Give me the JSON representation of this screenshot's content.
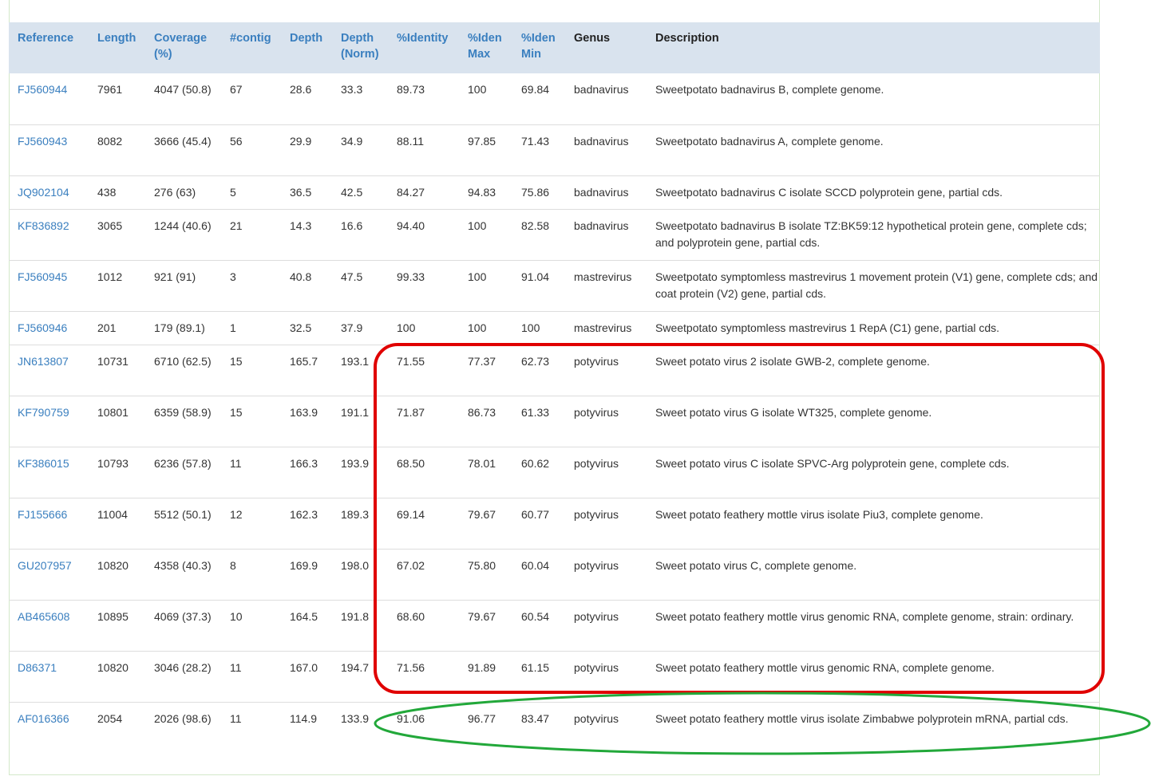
{
  "headers": [
    "Reference",
    "Length",
    "Coverage (%)",
    "#contig",
    "Depth",
    "Depth (Norm)",
    "%Identity",
    "%Iden Max",
    "%Iden Min",
    "Genus",
    "Description"
  ],
  "rows": [
    {
      "ref": "FJ560944",
      "length": "7961",
      "coverage": "4047 (50.8)",
      "contig": "67",
      "depth": "28.6",
      "depth_norm": "33.3",
      "identity": "89.73",
      "iden_max": "100",
      "iden_min": "69.84",
      "genus": "badnavirus",
      "desc": "Sweetpotato badnavirus B, complete genome."
    },
    {
      "ref": "FJ560943",
      "length": "8082",
      "coverage": "3666 (45.4)",
      "contig": "56",
      "depth": "29.9",
      "depth_norm": "34.9",
      "identity": "88.11",
      "iden_max": "97.85",
      "iden_min": "71.43",
      "genus": "badnavirus",
      "desc": "Sweetpotato badnavirus A, complete genome."
    },
    {
      "ref": "JQ902104",
      "length": "438",
      "coverage": "276 (63)",
      "contig": "5",
      "depth": "36.5",
      "depth_norm": "42.5",
      "identity": "84.27",
      "iden_max": "94.83",
      "iden_min": "75.86",
      "genus": "badnavirus",
      "desc": "Sweetpotato badnavirus C isolate SCCD polyprotein gene, partial cds."
    },
    {
      "ref": "KF836892",
      "length": "3065",
      "coverage": "1244 (40.6)",
      "contig": "21",
      "depth": "14.3",
      "depth_norm": "16.6",
      "identity": "94.40",
      "iden_max": "100",
      "iden_min": "82.58",
      "genus": "badnavirus",
      "desc": "Sweetpotato badnavirus B isolate TZ:BK59:12 hypothetical protein gene, complete cds; and polyprotein gene, partial cds."
    },
    {
      "ref": "FJ560945",
      "length": "1012",
      "coverage": "921 (91)",
      "contig": "3",
      "depth": "40.8",
      "depth_norm": "47.5",
      "identity": "99.33",
      "iden_max": "100",
      "iden_min": "91.04",
      "genus": "mastrevirus",
      "desc": "Sweetpotato symptomless mastrevirus 1 movement protein (V1) gene, complete cds; and coat protein (V2) gene, partial cds."
    },
    {
      "ref": "FJ560946",
      "length": "201",
      "coverage": "179 (89.1)",
      "contig": "1",
      "depth": "32.5",
      "depth_norm": "37.9",
      "identity": "100",
      "iden_max": "100",
      "iden_min": "100",
      "genus": "mastrevirus",
      "desc": "Sweetpotato symptomless mastrevirus 1 RepA (C1) gene, partial cds."
    },
    {
      "ref": "JN613807",
      "length": "10731",
      "coverage": "6710 (62.5)",
      "contig": "15",
      "depth": "165.7",
      "depth_norm": "193.1",
      "identity": "71.55",
      "iden_max": "77.37",
      "iden_min": "62.73",
      "genus": "potyvirus",
      "desc": "Sweet potato virus 2 isolate GWB-2, complete genome."
    },
    {
      "ref": "KF790759",
      "length": "10801",
      "coverage": "6359 (58.9)",
      "contig": "15",
      "depth": "163.9",
      "depth_norm": "191.1",
      "identity": "71.87",
      "iden_max": "86.73",
      "iden_min": "61.33",
      "genus": "potyvirus",
      "desc": "Sweet potato virus G isolate WT325, complete genome."
    },
    {
      "ref": "KF386015",
      "length": "10793",
      "coverage": "6236 (57.8)",
      "contig": "11",
      "depth": "166.3",
      "depth_norm": "193.9",
      "identity": "68.50",
      "iden_max": "78.01",
      "iden_min": "60.62",
      "genus": "potyvirus",
      "desc": "Sweet potato virus C isolate SPVC-Arg polyprotein gene, complete cds."
    },
    {
      "ref": "FJ155666",
      "length": "11004",
      "coverage": "5512 (50.1)",
      "contig": "12",
      "depth": "162.3",
      "depth_norm": "189.3",
      "identity": "69.14",
      "iden_max": "79.67",
      "iden_min": "60.77",
      "genus": "potyvirus",
      "desc": "Sweet potato feathery mottle virus isolate Piu3, complete genome."
    },
    {
      "ref": "GU207957",
      "length": "10820",
      "coverage": "4358 (40.3)",
      "contig": "8",
      "depth": "169.9",
      "depth_norm": "198.0",
      "identity": "67.02",
      "iden_max": "75.80",
      "iden_min": "60.04",
      "genus": "potyvirus",
      "desc": "Sweet potato virus C, complete genome."
    },
    {
      "ref": "AB465608",
      "length": "10895",
      "coverage": "4069 (37.3)",
      "contig": "10",
      "depth": "164.5",
      "depth_norm": "191.8",
      "identity": "68.60",
      "iden_max": "79.67",
      "iden_min": "60.54",
      "genus": "potyvirus",
      "desc": "Sweet potato feathery mottle virus genomic RNA, complete genome, strain: ordinary."
    },
    {
      "ref": "D86371",
      "length": "10820",
      "coverage": "3046 (28.2)",
      "contig": "11",
      "depth": "167.0",
      "depth_norm": "194.7",
      "identity": "71.56",
      "iden_max": "91.89",
      "iden_min": "61.15",
      "genus": "potyvirus",
      "desc": "Sweet potato feathery mottle virus genomic RNA, complete genome."
    },
    {
      "ref": "AF016366",
      "length": "2054",
      "coverage": "2026 (98.6)",
      "contig": "11",
      "depth": "114.9",
      "depth_norm": "133.9",
      "identity": "91.06",
      "iden_max": "96.77",
      "iden_min": "83.47",
      "genus": "potyvirus",
      "desc": "Sweet potato feathery mottle virus isolate Zimbabwe polyprotein mRNA, partial cds."
    }
  ],
  "colors": {
    "header_bg": "#d9e3ee",
    "link": "#3a7fbf",
    "red_box": "#e00000",
    "green_ellipse": "#22a83a"
  }
}
